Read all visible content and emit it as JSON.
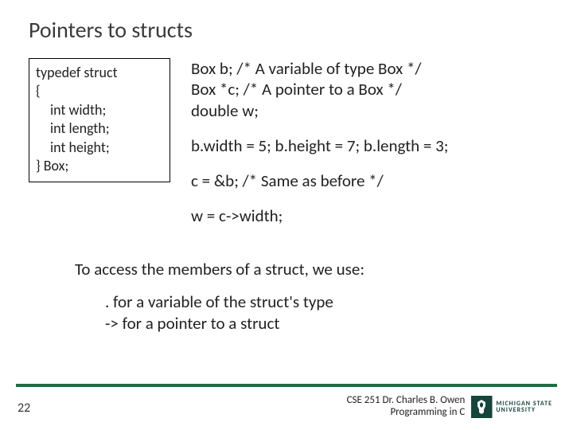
{
  "title": "Pointers to structs",
  "struct_def": {
    "line1": "typedef struct",
    "line2": "{",
    "line3": "int width;",
    "line4": "int length;",
    "line5": "int height;",
    "line6": "} Box;"
  },
  "code": {
    "decl1": "Box b;  /* A variable of type Box */",
    "decl2": "Box *c; /* A pointer to a Box */",
    "decl3": "double  w;",
    "assign": "b.width = 5;  b.height = 7;  b.length = 3;",
    "ptr_assign": "c = &b; /* Same as before */",
    "access": "w = c->width;"
  },
  "explain": {
    "intro": "To access the members of a struct, we use:",
    "dot": ". for a variable of the struct's type",
    "arrow": "-> for a pointer to a struct"
  },
  "footer": {
    "page": "22",
    "line1": "CSE 251 Dr. Charles B. Owen",
    "line2": "Programming in C",
    "msu1": "MICHIGAN STATE",
    "msu2": "UNIVERSITY"
  }
}
